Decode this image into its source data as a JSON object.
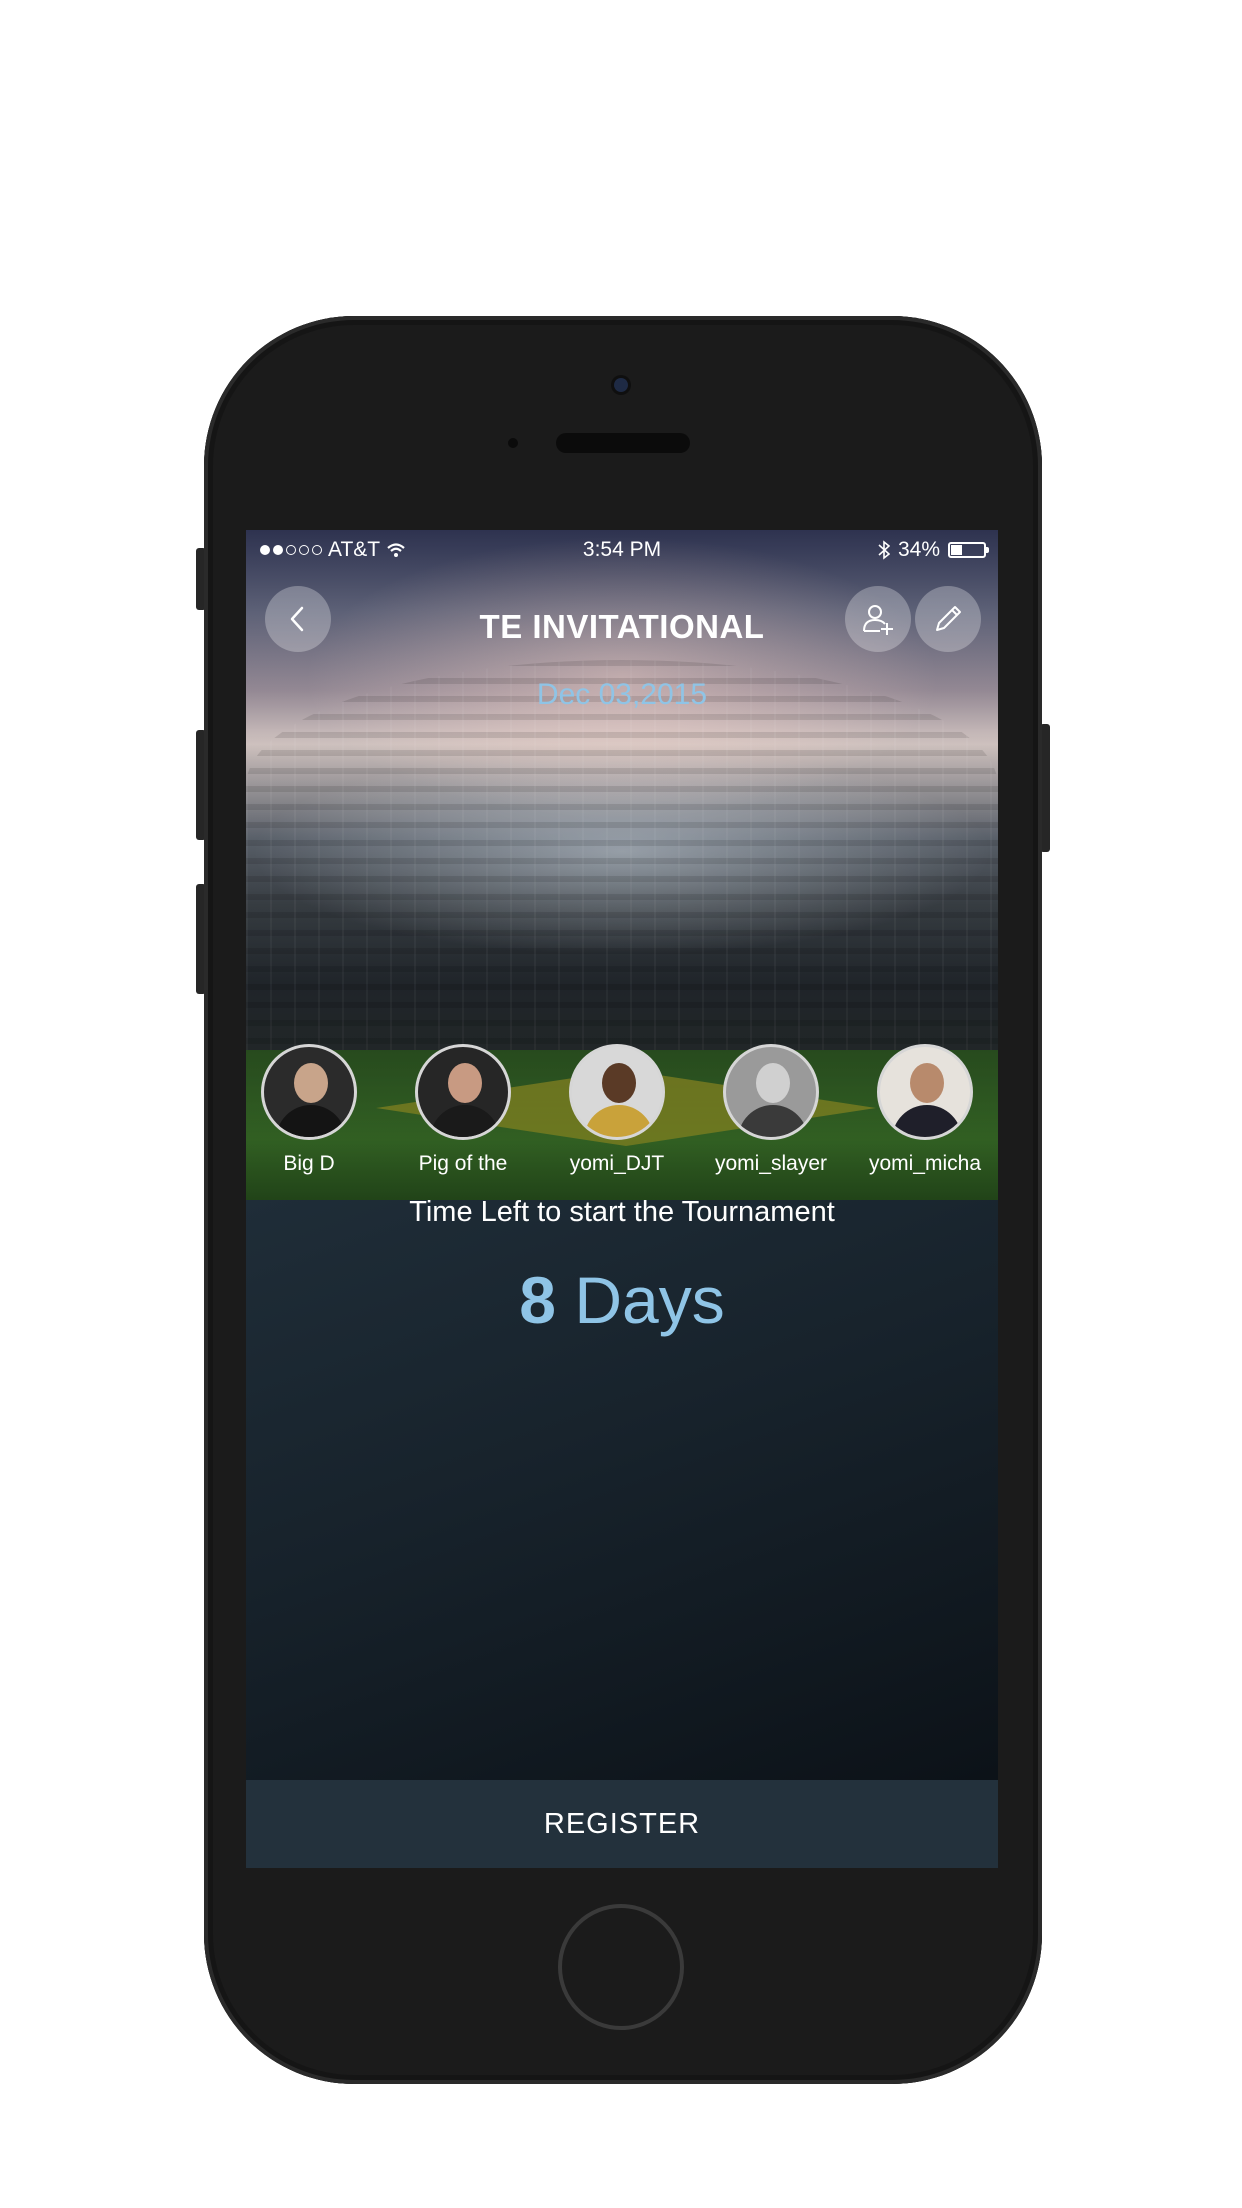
{
  "status_bar": {
    "carrier": "AT&T",
    "time": "3:54 PM",
    "battery": "34%",
    "battery_level": 0.34,
    "signal_bars_filled": 2,
    "signal_bars_total": 5
  },
  "header": {
    "title": "TE INVITATIONAL",
    "date": "Dec 03,2015",
    "back_icon": "chevron-left-icon",
    "add_user_icon": "add-user-icon",
    "edit_icon": "pencil-icon"
  },
  "participants": [
    {
      "name": "Big D"
    },
    {
      "name": "Pig of the"
    },
    {
      "name": "yomi_DJT"
    },
    {
      "name": "yomi_slayer"
    },
    {
      "name": "yomi_micha"
    }
  ],
  "countdown": {
    "label": "Time Left to start the Tournament",
    "value": "8",
    "unit": "Days"
  },
  "register_label": "REGISTER",
  "colors": {
    "accent": "#8fc4e6",
    "register_bg": "#23313c",
    "panel_bg": "#17222b"
  }
}
